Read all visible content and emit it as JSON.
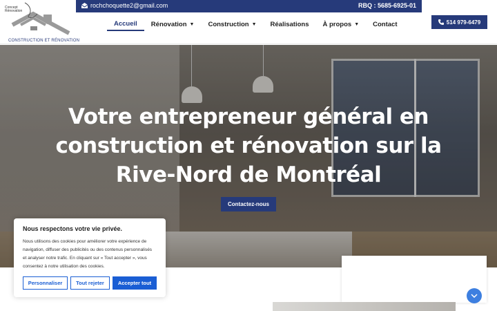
{
  "logo": {
    "brand_small": "Concept Rénovation",
    "brand_bottom": "CONSTRUCTION ET RÉNOVATION",
    "icon": "house-logo-icon"
  },
  "topbar": {
    "email": "rochchoquette2@gmail.com",
    "rbq": "RBQ : 5685-6925-01",
    "email_icon": "mail-icon"
  },
  "nav": {
    "items": [
      {
        "label": "Accueil",
        "active": true
      },
      {
        "label": "Rénovation",
        "dropdown": true
      },
      {
        "label": "Construction",
        "dropdown": true
      },
      {
        "label": "Réalisations"
      },
      {
        "label": "À propos",
        "dropdown": true
      },
      {
        "label": "Contact"
      }
    ]
  },
  "phone": {
    "label": "514 979-6479",
    "icon": "phone-icon"
  },
  "hero": {
    "title_line1": "Votre entrepreneur général en",
    "title_line2": "construction et rénovation sur la",
    "title_line3": "Rive-Nord de Montréal",
    "cta": "Contactez-nous"
  },
  "cookie": {
    "title": "Nous respectons votre vie privée.",
    "body": "Nous utilisons des cookies pour améliorer votre expérience de navigation, diffuser des publicités ou des contenus personnalisés et analyser notre trafic. En cliquant sur « Tout accepter », vous consentez à notre utilisation des cookies.",
    "customize": "Personnaliser",
    "reject": "Tout rejeter",
    "accept": "Accepter tout"
  },
  "scroll_icon": "chevron-down-icon",
  "colors": {
    "brand": "#263a7a",
    "cookie_accent": "#1a5ed4"
  }
}
